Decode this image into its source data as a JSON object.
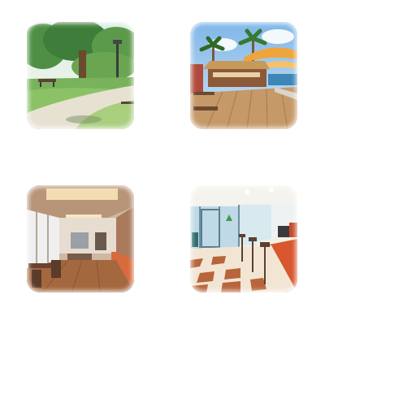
{
  "grid": {
    "tiles": [
      {
        "icon": "park-path-scene-icon",
        "accent": "#3f7a32"
      },
      {
        "icon": "beach-cafe-scene-icon",
        "accent": "#e39a2d"
      },
      {
        "icon": "lounge-interior-scene-icon",
        "accent": "#8a5a34"
      },
      {
        "icon": "diner-counter-scene-icon",
        "accent": "#c5532b"
      }
    ]
  }
}
